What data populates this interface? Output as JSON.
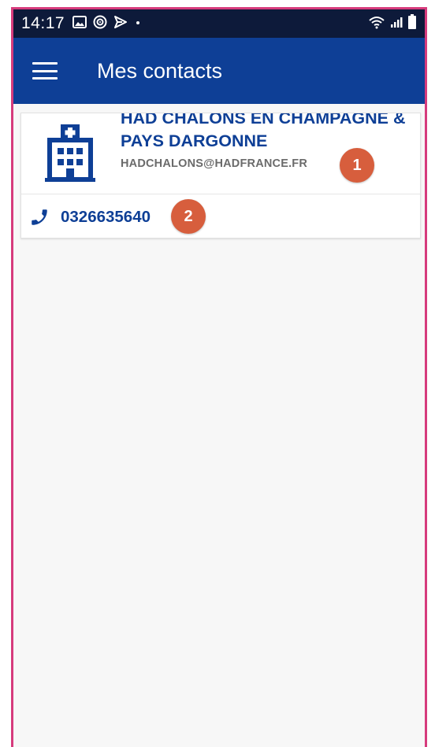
{
  "status_bar": {
    "time": "14:17",
    "left_icons": [
      "image-icon",
      "target-icon",
      "send-icon",
      "dot-icon"
    ],
    "right_icons": [
      "wifi-icon",
      "signal-icon",
      "battery-icon"
    ]
  },
  "app_bar": {
    "menu_icon": "menu-icon",
    "title": "Mes contacts"
  },
  "contact": {
    "icon": "hospital-icon",
    "name": "HAD CHALONS EN CHAMPAGNE & PAYS DARGONNE",
    "email": "HADCHALONS@HADFRANCE.FR",
    "phone_icon": "phone-icon",
    "phone": "0326635640"
  },
  "annotations": {
    "badge_1": "1",
    "badge_2": "2"
  },
  "colors": {
    "status_bar": "#0d1a3a",
    "app_bar": "#0e3f96",
    "primary_text": "#0e3f96",
    "email_text": "#6b6b6b",
    "badge": "#d75e3d",
    "frame_border": "#d63b7c",
    "background": "#f7f7f7"
  }
}
